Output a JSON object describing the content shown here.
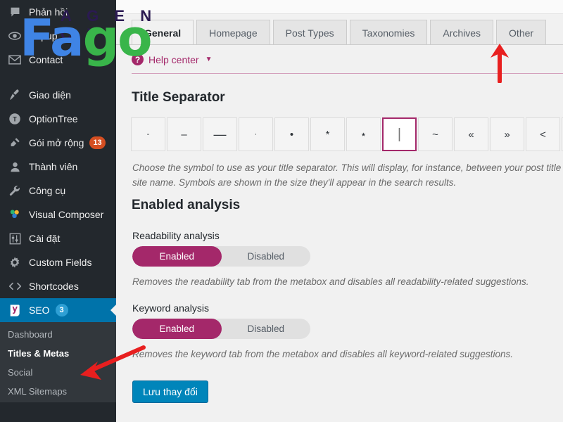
{
  "sidebar": {
    "items": [
      {
        "label": "Phản hồi",
        "icon": "comment-icon",
        "badge": null,
        "current": false
      },
      {
        "label": "Popup",
        "icon": "popup-icon",
        "badge": null,
        "current": false
      },
      {
        "label": "Contact",
        "icon": "envelope-icon",
        "badge": null,
        "current": false
      },
      {
        "label": "Giao diện",
        "icon": "paintbrush-icon",
        "badge": null,
        "current": false
      },
      {
        "label": "OptionTree",
        "icon": "optiontree-icon",
        "badge": null,
        "current": false
      },
      {
        "label": "Gói mở rộng",
        "icon": "plugin-icon",
        "badge": "13",
        "current": false
      },
      {
        "label": "Thành viên",
        "icon": "user-icon",
        "badge": null,
        "current": false
      },
      {
        "label": "Công cụ",
        "icon": "wrench-icon",
        "badge": null,
        "current": false
      },
      {
        "label": "Visual Composer",
        "icon": "visual-composer-icon",
        "badge": null,
        "current": false
      },
      {
        "label": "Cài đặt",
        "icon": "sliders-icon",
        "badge": null,
        "current": false
      },
      {
        "label": "Custom Fields",
        "icon": "gear-icon",
        "badge": null,
        "current": false
      },
      {
        "label": "Shortcodes",
        "icon": "code-icon",
        "badge": null,
        "current": false
      },
      {
        "label": "SEO",
        "icon": "yoast-icon",
        "badge": "3",
        "current": true
      }
    ],
    "submenu": [
      {
        "label": "Dashboard",
        "current": false
      },
      {
        "label": "Titles & Metas",
        "current": true
      },
      {
        "label": "Social",
        "current": false
      },
      {
        "label": "XML Sitemaps",
        "current": false
      }
    ]
  },
  "watermark": {
    "agency": "A G E N C Y",
    "name_part1": "Fa",
    "name_part2": "go"
  },
  "main": {
    "tabs": [
      {
        "label": "General",
        "active": true
      },
      {
        "label": "Homepage",
        "active": false
      },
      {
        "label": "Post Types",
        "active": false
      },
      {
        "label": "Taxonomies",
        "active": false
      },
      {
        "label": "Archives",
        "active": false
      },
      {
        "label": "Other",
        "active": false
      }
    ],
    "help_center": {
      "icon_glyph": "?",
      "label": "Help center",
      "caret": "▼"
    },
    "title_separator": {
      "heading": "Title Separator",
      "options": [
        {
          "glyph": "-",
          "size": "sm",
          "selected": false
        },
        {
          "glyph": "–",
          "size": "md",
          "selected": false
        },
        {
          "glyph": "—",
          "size": "lg",
          "selected": false
        },
        {
          "glyph": "·",
          "size": "sm",
          "selected": false
        },
        {
          "glyph": "•",
          "size": "md",
          "selected": false
        },
        {
          "glyph": "*",
          "size": "md",
          "selected": false
        },
        {
          "glyph": "⋆",
          "size": "md",
          "selected": false
        },
        {
          "glyph": "|",
          "size": "bar",
          "selected": true
        },
        {
          "glyph": "~",
          "size": "md",
          "selected": false
        },
        {
          "glyph": "«",
          "size": "md",
          "selected": false
        },
        {
          "glyph": "»",
          "size": "md",
          "selected": false
        },
        {
          "glyph": "<",
          "size": "md",
          "selected": false
        },
        {
          "glyph": ">",
          "size": "md",
          "selected": false
        }
      ],
      "description_line1": "Choose the symbol to use as your title separator. This will display, for instance, between your post title and",
      "description_line2": "site name. Symbols are shown in the size they'll appear in the search results."
    },
    "enabled_analysis": {
      "heading": "Enabled analysis",
      "fields": [
        {
          "label": "Readability analysis",
          "enabled_label": "Enabled",
          "disabled_label": "Disabled",
          "value": "Enabled",
          "description": "Removes the readability tab from the metabox and disables all readability-related suggestions."
        },
        {
          "label": "Keyword analysis",
          "enabled_label": "Enabled",
          "disabled_label": "Disabled",
          "value": "Enabled",
          "description": "Removes the keyword tab from the metabox and disables all keyword-related suggestions."
        }
      ]
    },
    "save_button": "Lưu thay đổi"
  },
  "colors": {
    "accent_magenta": "#a4286a",
    "wp_blue": "#0073aa",
    "save_blue": "#0085ba",
    "sidebar_bg": "#23282d",
    "submenu_bg": "#32373c",
    "badge_orange": "#d54e21",
    "badge_blue": "#2e9fd4",
    "logo_blue": "#3f84e5",
    "logo_green": "#39b54a",
    "annotation_red": "#e81f1f"
  }
}
